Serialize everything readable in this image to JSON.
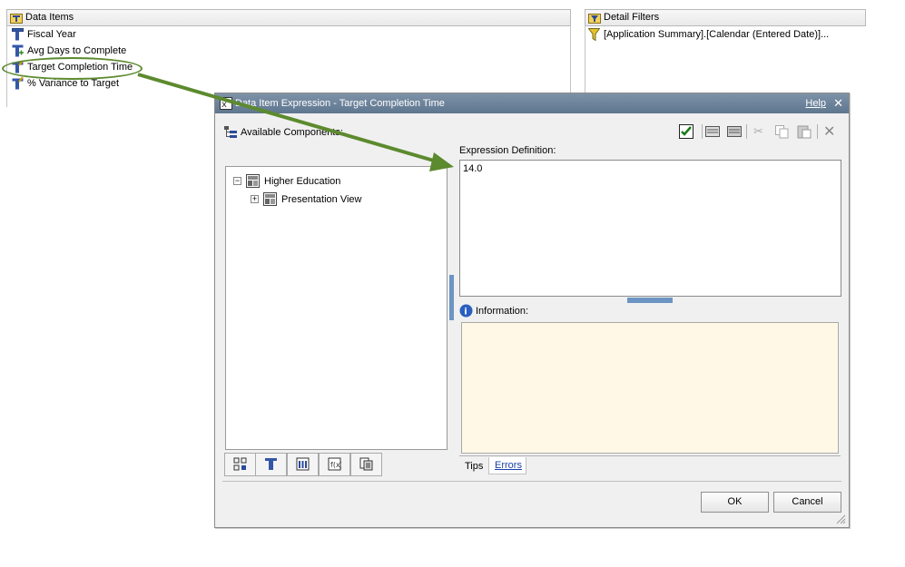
{
  "data_items": {
    "title": "Data Items",
    "items": [
      {
        "label": "Fiscal Year"
      },
      {
        "label": "Avg Days to Complete"
      },
      {
        "label": "Target Completion Time"
      },
      {
        "label": "% Variance to Target"
      }
    ]
  },
  "detail_filters": {
    "title": "Detail Filters",
    "items": [
      {
        "label": "[Application Summary].[Calendar (Entered Date)]..."
      }
    ]
  },
  "dialog": {
    "title": "Data Item Expression - Target Completion Time",
    "help_label": "Help",
    "available_components_label": "Available Components:",
    "tree": {
      "root": "Higher Education",
      "child": "Presentation View"
    },
    "expression_label": "Expression Definition:",
    "expression_value": "14.0",
    "information_label": "Information:",
    "tabs": [
      "Tips",
      "Errors"
    ],
    "ok_label": "OK",
    "cancel_label": "Cancel"
  },
  "colors": {
    "annotation_green": "#5c8a2e",
    "info_background": "#fff8e6",
    "title_bar": "#6b8198"
  }
}
